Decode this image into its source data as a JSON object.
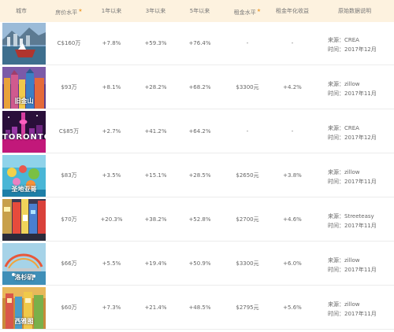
{
  "header": {
    "city": "城市",
    "price": "房价水平",
    "y1": "1年以来",
    "y3": "3年以来",
    "y5": "5年以来",
    "rent": "租金水平",
    "yield": "租金年化收益",
    "source": "原始数据说明"
  },
  "rows": [
    {
      "caption": "",
      "price": "C$160万",
      "y1": "+7.8%",
      "y3": "+59.3%",
      "y5": "+76.4%",
      "rent": "-",
      "yield": "-",
      "source": "来源：CREA",
      "time": "时间：2017年12月"
    },
    {
      "caption": "旧金山",
      "price": "$93万",
      "y1": "+8.1%",
      "y3": "+28.2%",
      "y5": "+68.2%",
      "rent": "$3300元",
      "yield": "+4.2%",
      "source": "来源：zillow",
      "time": "时间：2017年11月"
    },
    {
      "caption": "TORONTO",
      "price": "C$85万",
      "y1": "+2.7%",
      "y3": "+41.2%",
      "y5": "+64.2%",
      "rent": "-",
      "yield": "-",
      "source": "来源：CREA",
      "time": "时间：2017年12月"
    },
    {
      "caption": "圣地亚哥",
      "price": "$83万",
      "y1": "+3.5%",
      "y3": "+15.1%",
      "y5": "+28.5%",
      "rent": "$2650元",
      "yield": "+3.8%",
      "source": "来源：zillow",
      "time": "时间：2017年11月"
    },
    {
      "caption": "",
      "price": "$70万",
      "y1": "+20.3%",
      "y3": "+38.2%",
      "y5": "+52.8%",
      "rent": "$2700元",
      "yield": "+4.6%",
      "source": "来源：Streeteasy",
      "time": "时间：2017年11月"
    },
    {
      "caption": "洛杉矶",
      "price": "$66万",
      "y1": "+5.5%",
      "y3": "+19.4%",
      "y5": "+50.9%",
      "rent": "$3300元",
      "yield": "+6.0%",
      "source": "来源：zillow",
      "time": "时间：2017年11月"
    },
    {
      "caption": "西雅图",
      "price": "$60万",
      "y1": "+7.3%",
      "y3": "+21.4%",
      "y5": "+48.5%",
      "rent": "$2795元",
      "yield": "+5.6%",
      "source": "来源：zillow",
      "time": "时间：2017年11月"
    }
  ],
  "icons": {
    "star": "star-icon"
  },
  "colors": {
    "header_bg": "#fdf2df",
    "star": "#f0a33a",
    "text": "#666666"
  }
}
